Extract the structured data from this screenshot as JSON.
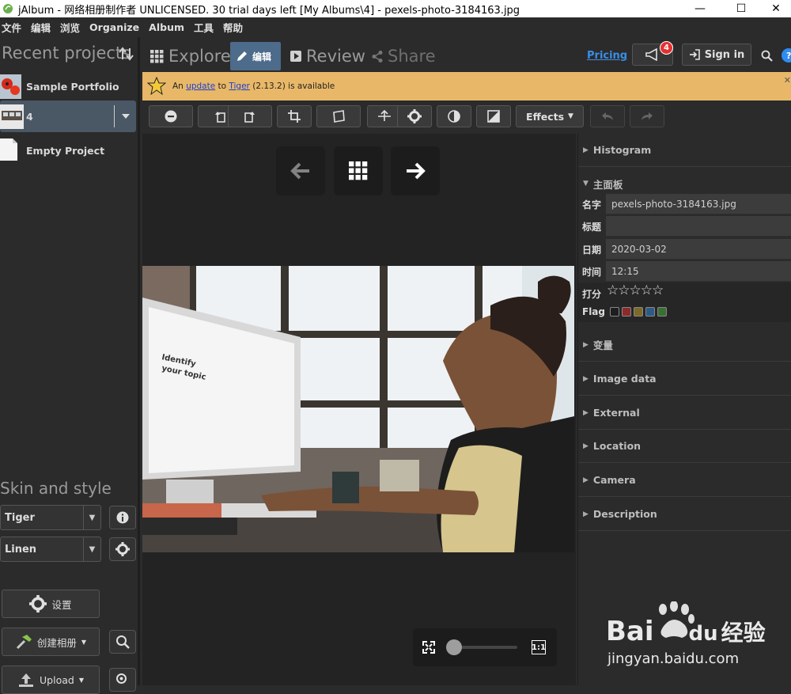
{
  "window": {
    "title": "jAlbum - 网络相册制作者 UNLICENSED. 30 trial days left [My Albums\\4] - pexels-photo-3184163.jpg"
  },
  "menu": [
    "文件",
    "编辑",
    "浏览",
    "Organize",
    "Album",
    "工具",
    "帮助"
  ],
  "left": {
    "recent_heading": "Recent projects",
    "projects": [
      {
        "label": "Sample Portfolio"
      },
      {
        "label": "4"
      },
      {
        "label": "Empty Project"
      }
    ],
    "skin_heading": "Skin and style",
    "skin_value": "Tiger",
    "style_value": "Linen",
    "settings_label": "设置",
    "make_album_label": "创建相册",
    "upload_label": "Upload"
  },
  "nav": {
    "explore": "Explore",
    "edit": "编辑",
    "review": "Review",
    "share": "Share",
    "pricing": "Pricing",
    "notifications_count": "4",
    "sign_in": "Sign in"
  },
  "notice": {
    "prefix": "An",
    "link1": "update",
    "mid": "to",
    "link2": "Tiger",
    "suffix": "(2.13.2) is available"
  },
  "edit_toolbar": {
    "effects": "Effects"
  },
  "zoom": {
    "one_to_one": "1:1",
    "level": 0.05
  },
  "right": {
    "histogram": "Histogram",
    "main_panel": "主面板",
    "fields": [
      {
        "label": "名字",
        "value": "pexels-photo-3184163.jpg"
      },
      {
        "label": "标题",
        "value": ""
      },
      {
        "label": "日期",
        "value": "2020-03-02"
      },
      {
        "label": "时间",
        "value": "12:15"
      }
    ],
    "rating_label": "打分",
    "rating_stars": "☆☆☆☆☆",
    "flag_label": "Flag",
    "flag_colors": [
      "#1e1e1e",
      "#8b2c2c",
      "#7d6a2a",
      "#2e5b85",
      "#3a6e35"
    ],
    "sections": [
      "变量",
      "Image data",
      "External",
      "Location",
      "Camera",
      "Description"
    ]
  },
  "watermark": {
    "brand": "Bai",
    "brand2": "du",
    "brand_cn": "经验",
    "url": "jingyan.baidu.com"
  },
  "colors": {
    "accent": "#4d6b8a",
    "notice_bg": "#e8b868",
    "badge": "#e53030",
    "link": "#3a8ee6"
  }
}
